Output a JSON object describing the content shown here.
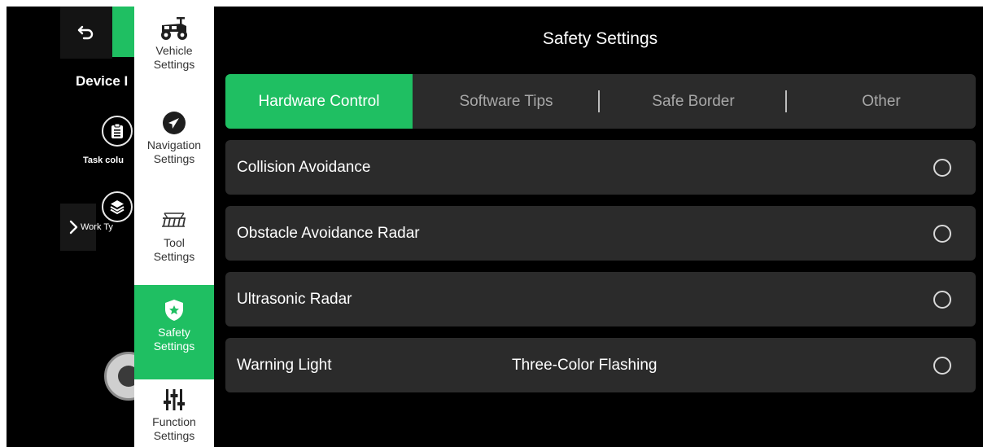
{
  "background_panel": {
    "device_label": "Device I",
    "task_label": "Task colu",
    "work_label": "Work Ty"
  },
  "categories": [
    {
      "label": "Vehicle\nSettings",
      "icon": "vehicle-icon",
      "active": false
    },
    {
      "label": "Navigation\nSettings",
      "icon": "navigation-icon",
      "active": false
    },
    {
      "label": "Tool\nSettings",
      "icon": "tool-icon",
      "active": false
    },
    {
      "label": "Safety\nSettings",
      "icon": "shield-star-icon",
      "active": true
    },
    {
      "label": "Function\nSettings",
      "icon": "sliders-icon",
      "active": false
    }
  ],
  "page": {
    "title": "Safety Settings"
  },
  "tabs": [
    {
      "label": "Hardware Control",
      "active": true
    },
    {
      "label": "Software Tips",
      "active": false
    },
    {
      "label": "Safe Border",
      "active": false
    },
    {
      "label": "Other",
      "active": false
    }
  ],
  "settings": [
    {
      "label": "Collision Avoidance",
      "value": "",
      "selected": false
    },
    {
      "label": "Obstacle Avoidance Radar",
      "value": "",
      "selected": false
    },
    {
      "label": "Ultrasonic Radar",
      "value": "",
      "selected": false
    },
    {
      "label": "Warning Light",
      "value": "Three-Color Flashing",
      "selected": false
    }
  ],
  "colors": {
    "accent": "#1fbf62",
    "background": "#000000",
    "card": "#2b2b2b",
    "menu_bg": "#ffffff"
  }
}
